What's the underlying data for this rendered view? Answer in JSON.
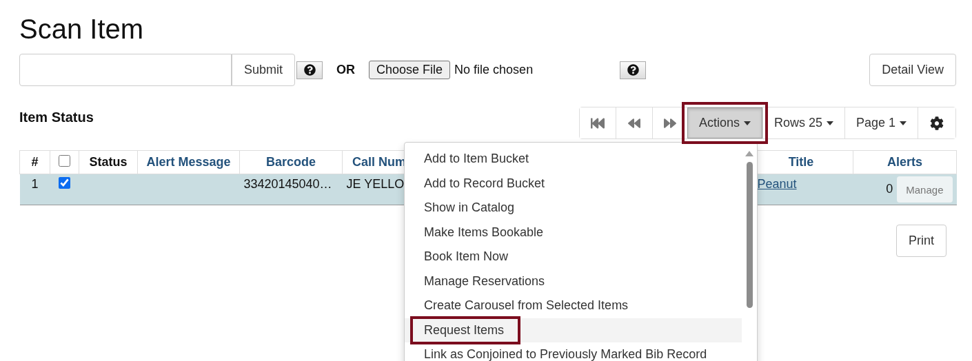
{
  "page_title": "Scan Item",
  "scan_form": {
    "submit": "Submit",
    "or_label": "OR",
    "file_button": "Choose File",
    "file_status": "No file chosen",
    "detail_view": "Detail View"
  },
  "section_title": "Item Status",
  "toolbar": {
    "dropdowns": [
      {
        "label": "Actions",
        "open": true,
        "annotated": true
      },
      {
        "label": "Rows 25",
        "open": false,
        "annotated": false
      },
      {
        "label": "Page 1",
        "open": false,
        "annotated": false
      }
    ]
  },
  "actions_menu": {
    "items": [
      {
        "label": "Add to Item Bucket",
        "hovered": false,
        "annotated": false
      },
      {
        "label": "Add to Record Bucket",
        "hovered": false,
        "annotated": false
      },
      {
        "label": "Show in Catalog",
        "hovered": false,
        "annotated": false
      },
      {
        "label": "Make Items Bookable",
        "hovered": false,
        "annotated": false
      },
      {
        "label": "Book Item Now",
        "hovered": false,
        "annotated": false
      },
      {
        "label": "Manage Reservations",
        "hovered": false,
        "annotated": false
      },
      {
        "label": "Create Carousel from Selected Items",
        "hovered": false,
        "annotated": false
      },
      {
        "label": "Request Items",
        "hovered": true,
        "annotated": true
      },
      {
        "label": "Link as Conjoined to Previously Marked Bib Record",
        "hovered": false,
        "annotated": false
      }
    ]
  },
  "table": {
    "header_checked": false,
    "columns": [
      {
        "label": "#",
        "sortable": false
      },
      {
        "label": "Status",
        "sortable": false
      },
      {
        "label": "Alert Message",
        "sortable": true
      },
      {
        "label": "Barcode",
        "sortable": true
      },
      {
        "label": "Call Num",
        "sortable": true
      },
      {
        "label": "Title",
        "sortable": true
      },
      {
        "label": "Alerts",
        "sortable": true
      }
    ],
    "rows": [
      {
        "number": "1",
        "checked": true,
        "barcode": "33420145040…",
        "call_number": "JE YELLO",
        "title": "Peanut",
        "alerts_count": "0",
        "manage": "Manage"
      }
    ]
  },
  "print": "Print"
}
